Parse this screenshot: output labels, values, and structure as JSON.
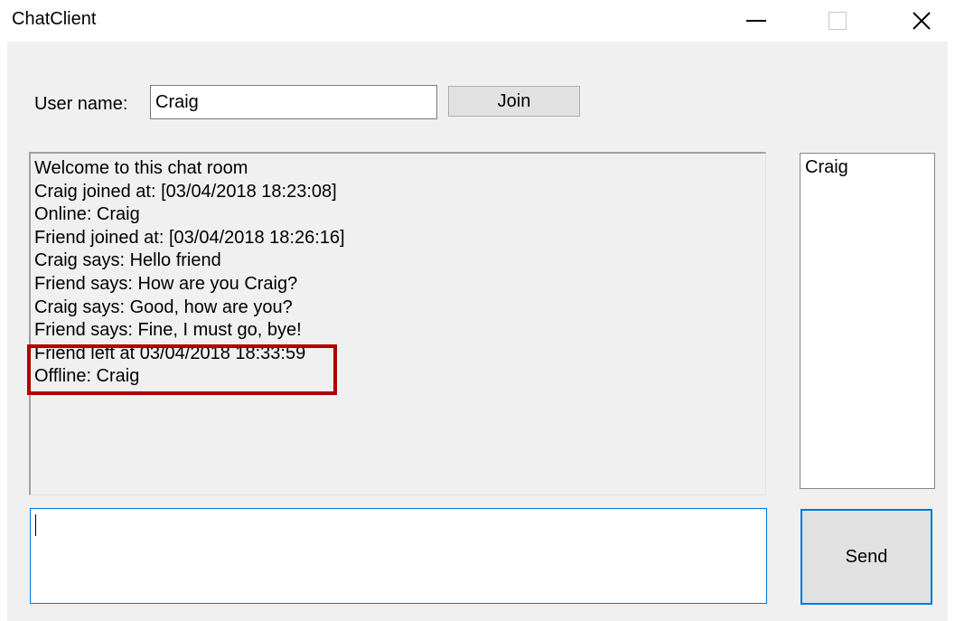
{
  "window": {
    "title": "ChatClient",
    "controls": [
      "minimize-icon",
      "maximize-icon",
      "close-icon"
    ]
  },
  "login": {
    "label": "User name:",
    "username_value": "Craig",
    "join_label": "Join"
  },
  "chat_log": {
    "lines": [
      "Welcome to this chat room",
      "Craig joined at: [03/04/2018 18:23:08]",
      "Online: Craig",
      "Friend joined at: [03/04/2018 18:26:16]",
      "Craig says: Hello friend",
      "Friend says: How are you Craig?",
      "Craig says: Good, how are you?",
      "Friend says: Fine, I must go, bye!",
      "Friend left at 03/04/2018 18:33:59",
      "Offline: Craig"
    ],
    "highlight_color": "#b00000"
  },
  "online_users": {
    "items": [
      "Craig"
    ]
  },
  "compose": {
    "message_value": "",
    "send_label": "Send"
  },
  "colors": {
    "focus_border": "#0078d7",
    "button_face": "#e1e1e1",
    "window_background": "#f0f0f0"
  }
}
